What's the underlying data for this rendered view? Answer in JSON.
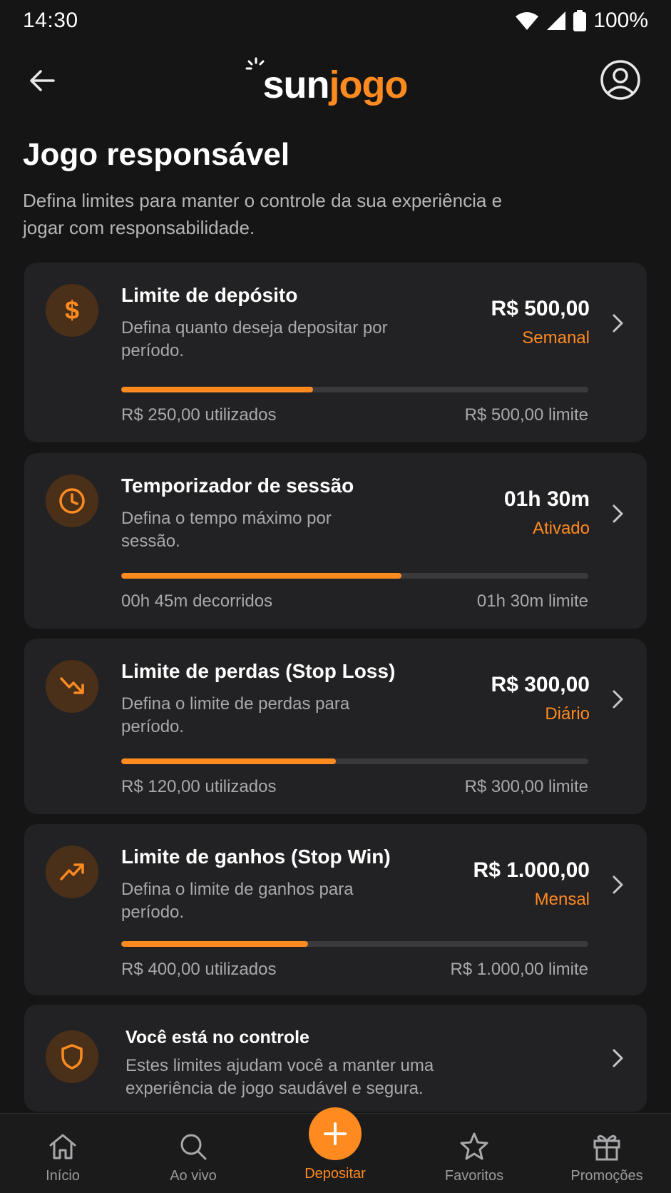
{
  "status_bar": {
    "time": "14:30",
    "battery": "100%",
    "icons": [
      "wifi-icon",
      "signal-icon",
      "battery-icon"
    ]
  },
  "header": {
    "logo_part1": "sun",
    "logo_part2": "jogo",
    "back_icon": "arrow-left-icon",
    "profile_icon": "user-circle-icon"
  },
  "page": {
    "title": "Jogo responsável",
    "subtitle": "Defina limites para manter o controle da sua experiência e jogar com responsabilidade."
  },
  "cards": [
    {
      "icon": "dollar-icon",
      "title": "Limite de depósito",
      "desc": "Defina quanto deseja depositar por período.",
      "value": "R$ 500,00",
      "period": "Semanal",
      "progress": 0.41,
      "left_text": "R$ 250,00 utilizados",
      "right_text": "R$ 500,00 limite"
    },
    {
      "icon": "clock-icon",
      "title": "Temporizador de sessão",
      "desc": "Defina o tempo máximo por sessão.",
      "value": "01h 30m",
      "period": "Ativado",
      "progress": 0.6,
      "left_text": "00h 45m decorridos",
      "right_text": "01h 30m limite"
    },
    {
      "icon": "trending-down-icon",
      "title": "Limite de perdas (Stop Loss)",
      "desc": "Defina o limite de perdas para período.",
      "value": "R$ 300,00",
      "period": "Diário",
      "progress": 0.46,
      "left_text": "R$ 120,00 utilizados",
      "right_text": "R$ 300,00 limite"
    },
    {
      "icon": "trending-up-icon",
      "title": "Limite de ganhos (Stop Win)",
      "desc": "Defina o limite de ganhos para período.",
      "value": "R$ 1.000,00",
      "period": "Mensal",
      "progress": 0.4,
      "left_text": "R$ 400,00 utilizados",
      "right_text": "R$ 1.000,00 limite"
    }
  ],
  "info": {
    "icon": "shield-icon",
    "title": "Você está no controle",
    "desc": "Estes limites ajudam você a manter uma experiência de jogo saudável e segura."
  },
  "nav": {
    "items": [
      {
        "label": "Início",
        "icon": "home-icon"
      },
      {
        "label": "Ao vivo",
        "icon": "search-icon"
      },
      {
        "label": "Depositar",
        "icon": "plus-icon",
        "active": true
      },
      {
        "label": "Favoritos",
        "icon": "star-icon"
      },
      {
        "label": "Promoções",
        "icon": "gift-icon"
      }
    ]
  },
  "colors": {
    "accent": "#ff8a1f",
    "background": "#151516",
    "card": "#222224"
  }
}
